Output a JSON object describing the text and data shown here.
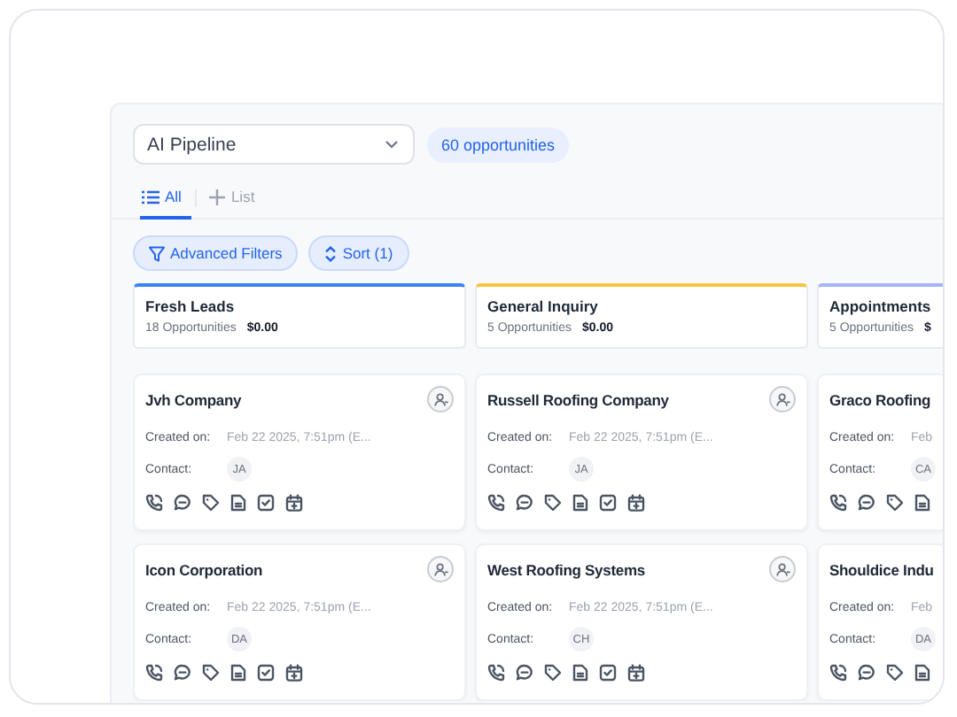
{
  "pipeline_select": {
    "value": "AI Pipeline"
  },
  "count_badge": "60 opportunities",
  "tabs": [
    {
      "label": "All",
      "selected": true
    },
    {
      "label": "List",
      "selected": false
    }
  ],
  "filters": [
    {
      "label": "Advanced Filters"
    },
    {
      "label": "Sort (1)"
    }
  ],
  "columns": [
    {
      "title": "Fresh Leads",
      "color": "#3b82f6",
      "count": "18 Opportunities",
      "amount": "$0.00",
      "cards": [
        {
          "name": "Jvh Company",
          "created_label": "Created on:",
          "created": "Feb 22 2025, 7:51pm (E...",
          "contact_label": "Contact:",
          "contact": "JA",
          "assign": true,
          "actions": [
            {
              "kind": "call"
            },
            {
              "kind": "chat"
            },
            {
              "kind": "tag"
            },
            {
              "kind": "note"
            },
            {
              "kind": "task"
            },
            {
              "kind": "event"
            }
          ]
        },
        {
          "name": "Icon Corporation",
          "created_label": "Created on:",
          "created": "Feb 22 2025, 7:51pm (E...",
          "contact_label": "Contact:",
          "contact": "DA",
          "assign": true,
          "actions": [
            {
              "kind": "call"
            },
            {
              "kind": "chat"
            },
            {
              "kind": "tag"
            },
            {
              "kind": "note"
            },
            {
              "kind": "task"
            },
            {
              "kind": "event"
            }
          ]
        }
      ]
    },
    {
      "title": "General Inquiry",
      "color": "#f5c542",
      "count": "5 Opportunities",
      "amount": "$0.00",
      "cards": [
        {
          "name": "Russell Roofing Company",
          "created_label": "Created on:",
          "created": "Feb 22 2025, 7:51pm (E...",
          "contact_label": "Contact:",
          "contact": "JA",
          "assign": true,
          "actions": [
            {
              "kind": "call"
            },
            {
              "kind": "chat"
            },
            {
              "kind": "tag"
            },
            {
              "kind": "note"
            },
            {
              "kind": "task"
            },
            {
              "kind": "event"
            }
          ]
        },
        {
          "name": "West Roofing Systems",
          "created_label": "Created on:",
          "created": "Feb 22 2025, 7:51pm (E...",
          "contact_label": "Contact:",
          "contact": "CH",
          "assign": true,
          "actions": [
            {
              "kind": "call"
            },
            {
              "kind": "chat"
            },
            {
              "kind": "tag"
            },
            {
              "kind": "note"
            },
            {
              "kind": "task"
            },
            {
              "kind": "event"
            }
          ]
        }
      ]
    },
    {
      "title": "Appointments",
      "color": "#a5b4fc",
      "count": "5 Opportunities",
      "amount": "$",
      "cards": [
        {
          "name": "Graco Roofing",
          "created_label": "Created on:",
          "created": "Feb",
          "contact_label": "Contact:",
          "contact": "CA",
          "assign": false,
          "actions": [
            {
              "kind": "call"
            },
            {
              "kind": "chat"
            },
            {
              "kind": "tag"
            },
            {
              "kind": "note"
            }
          ]
        },
        {
          "name": "Shouldice Indu",
          "created_label": "Created on:",
          "created": "Feb",
          "contact_label": "Contact:",
          "contact": "DA",
          "assign": false,
          "actions": [
            {
              "kind": "call"
            },
            {
              "kind": "chat"
            },
            {
              "kind": "tag"
            },
            {
              "kind": "note"
            }
          ]
        }
      ]
    }
  ]
}
